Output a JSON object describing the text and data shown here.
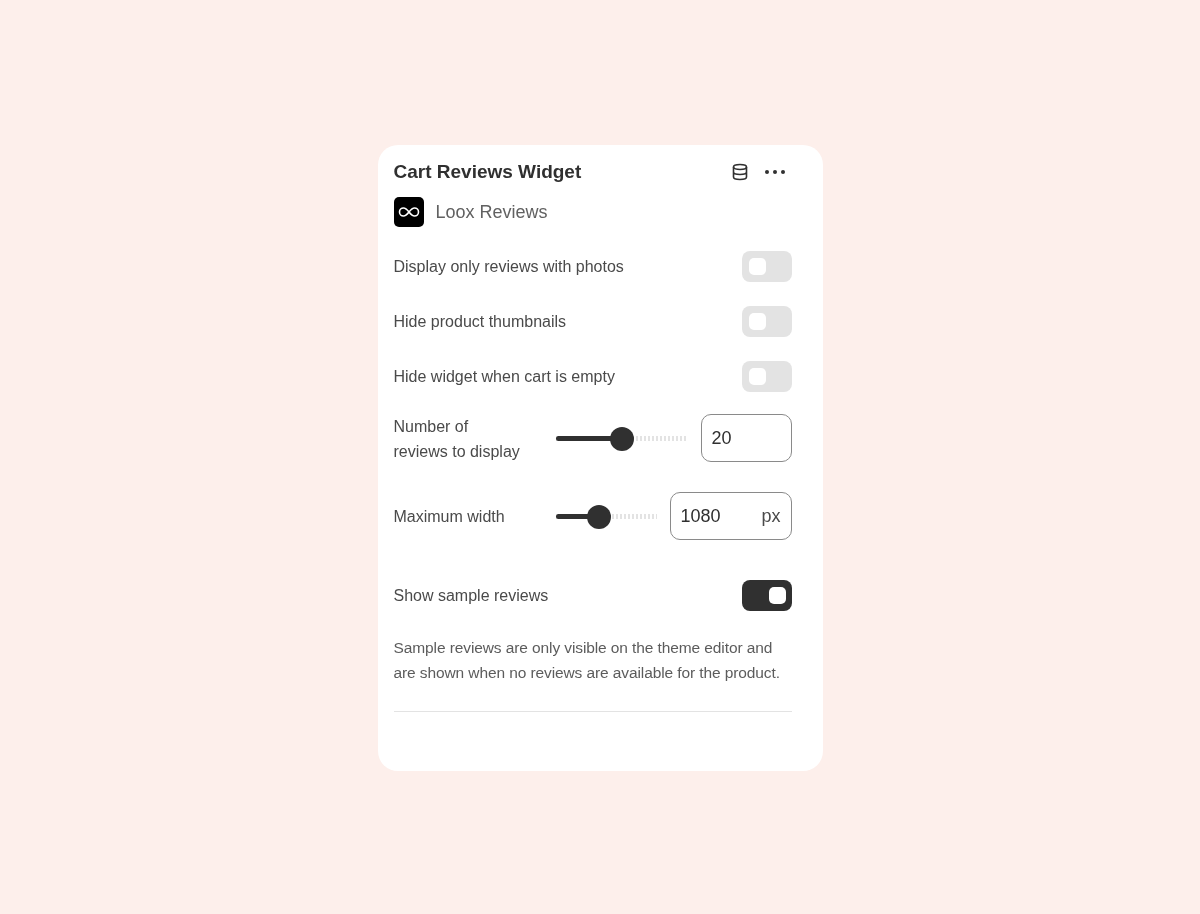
{
  "title": "Cart Reviews Widget",
  "app": {
    "name": "Loox Reviews"
  },
  "settings": [
    {
      "kind": "toggle",
      "label": "Display only reviews with photos",
      "on": false
    },
    {
      "kind": "toggle",
      "label": "Hide product thumbnails",
      "on": false
    },
    {
      "kind": "toggle",
      "label": "Hide widget when cart is empty",
      "on": false
    },
    {
      "kind": "slider",
      "label": "Number of reviews to display",
      "level": 0.5,
      "value": "20"
    },
    {
      "kind": "slider",
      "label": "Maximum width",
      "level": 0.43,
      "value": "1080",
      "unit": "px"
    },
    {
      "kind": "toggle",
      "label": "Show sample reviews",
      "on": true
    }
  ],
  "note": "Sample reviews are only visible on the theme editor and are shown when no reviews are available for the product."
}
